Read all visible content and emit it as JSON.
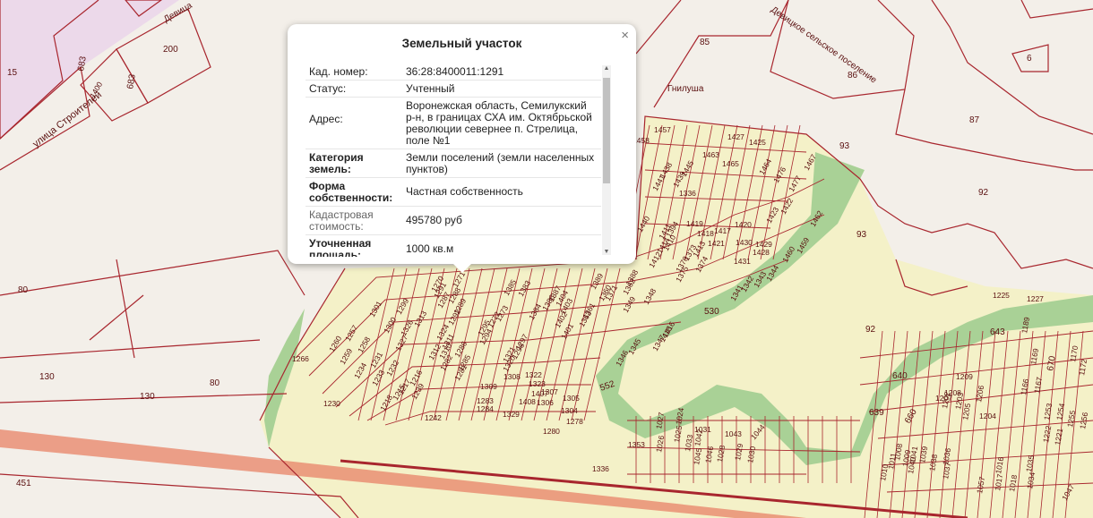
{
  "popup": {
    "title": "Земельный участок",
    "close_symbol": "×",
    "rows": [
      {
        "label": "Кад. номер:",
        "value": "36:28:8400011:1291"
      },
      {
        "label": "Статус:",
        "value": "Учтенный"
      },
      {
        "label": "Адрес:",
        "value": "Воронежская область, Семилукский р-н, в границах СХА им. Октябрьской революции севернее п. Стрелица, поле №1"
      },
      {
        "label": "Категория земель:",
        "value": "Земли поселений (земли населенных пунктов)"
      },
      {
        "label": "Форма собственности:",
        "value": "Частная собственность"
      },
      {
        "label": "Кадастровая стоимость:",
        "value": "495780 руб"
      },
      {
        "label": "Уточненная площадь:",
        "value": "1000 кв.м"
      }
    ]
  },
  "map": {
    "colors": {
      "parcel_line": "#a8262e",
      "settlement_fill": "#f4f1c8",
      "green_zone": "#a9d196",
      "industrial_fill": "#ecd9ea",
      "road": "#e88a6e",
      "background": "#f3efe9"
    },
    "road_labels": [
      "улица Строителей",
      "Девицкое сельское поселение",
      "Гнилуша",
      "Девица"
    ],
    "parcel_labels": [
      "15",
      "683",
      "683",
      "1400",
      "200",
      "85",
      "86",
      "87",
      "6",
      "93",
      "92",
      "93",
      "92",
      "80",
      "130",
      "130",
      "80",
      "451",
      "1336",
      "640",
      "639",
      "643",
      "660",
      "670",
      "1225",
      "1227",
      "1189",
      "1169",
      "1170",
      "1172",
      "1167",
      "1166",
      "1209",
      "1208",
      "1207",
      "1206",
      "1204",
      "1205",
      "1203",
      "1202",
      "1253",
      "1254",
      "1255",
      "1256",
      "1222",
      "1221",
      "1010",
      "1011",
      "1008",
      "1009",
      "1040",
      "1041",
      "1039",
      "1038",
      "1036",
      "1037",
      "1016",
      "1017",
      "1018",
      "1035",
      "1034",
      "1057",
      "1047",
      "1266",
      "1230",
      "1242",
      "1329",
      "1280",
      "1278",
      "1301",
      "1260",
      "1257",
      "1259",
      "1258",
      "1234",
      "1231",
      "1233",
      "1232",
      "1218",
      "1215",
      "1217",
      "1216",
      "1239",
      "1299",
      "1300",
      "1327",
      "1326",
      "1313",
      "1312",
      "1311",
      "1324",
      "1310",
      "1309",
      "1308",
      "1307",
      "1306",
      "1305",
      "1304",
      "1283",
      "1284",
      "1281",
      "1282",
      "1285",
      "1286",
      "1287",
      "1288",
      "1289",
      "1292",
      "1291",
      "1270",
      "1271",
      "1272",
      "1273",
      "1295",
      "1294",
      "1297",
      "1296",
      "1320",
      "1321",
      "1322",
      "1323",
      "1407",
      "1408",
      "1385",
      "1383",
      "1384",
      "1386",
      "1387",
      "1404",
      "1403",
      "1402",
      "1401",
      "1363",
      "1361",
      "1360",
      "1371",
      "1362",
      "1389",
      "1388",
      "1349",
      "1348",
      "1346",
      "1345",
      "1347",
      "1415",
      "1416",
      "1375",
      "1374",
      "1376",
      "1373",
      "1413",
      "1412",
      "1414",
      "1410",
      "1411",
      "1394",
      "1440",
      "1441",
      "1438",
      "1439",
      "1445",
      "1419",
      "1418",
      "1417",
      "1420",
      "1421",
      "1431",
      "1428",
      "1429",
      "1430",
      "1336",
      "1427",
      "1425",
      "1457",
      "1458",
      "1463",
      "1465",
      "1467",
      "1464",
      "1476",
      "1477",
      "1423",
      "1422",
      "1459",
      "1460",
      "1462",
      "1341",
      "1342",
      "1343",
      "1344",
      "530",
      "552",
      "1353",
      "1026",
      "1025",
      "1027",
      "1024",
      "1031",
      "1033",
      "1042",
      "1043",
      "1044",
      "1045",
      "1046",
      "1028",
      "1029",
      "1030"
    ]
  }
}
